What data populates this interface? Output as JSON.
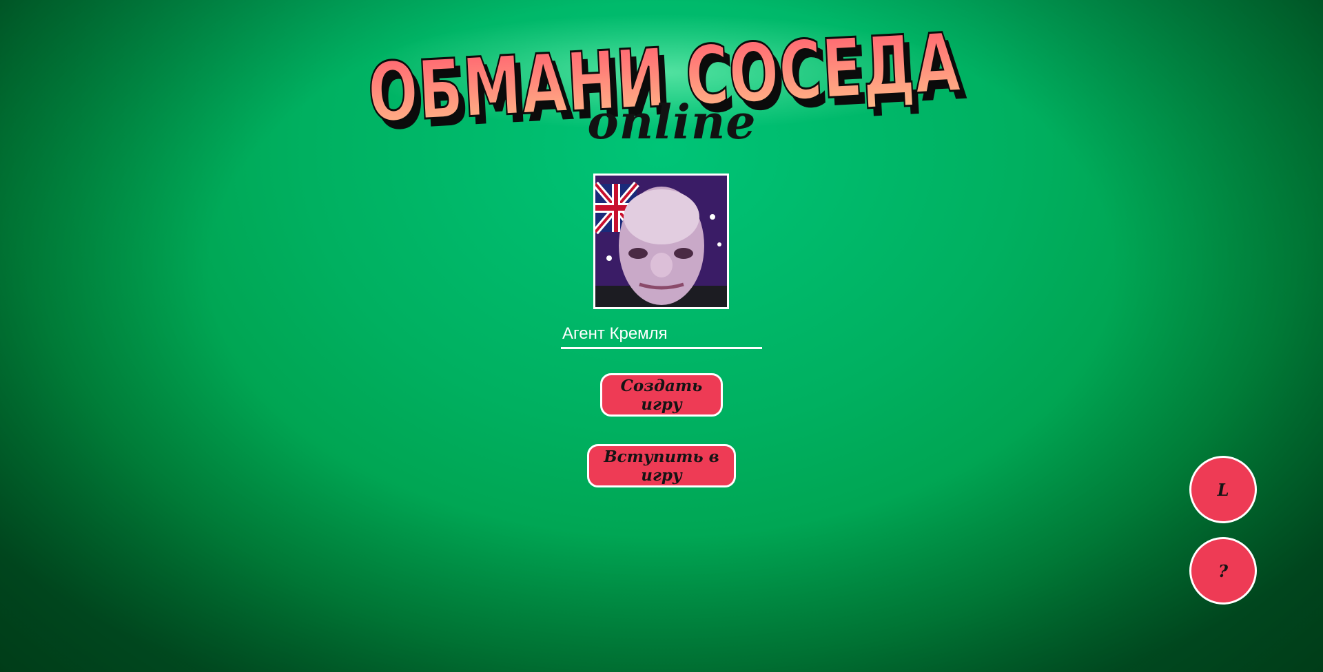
{
  "logo": {
    "title": "ОБМАНИ СОСЕДА",
    "subtitle": "online"
  },
  "player": {
    "name_value": "Агент Кремля"
  },
  "buttons": {
    "create_game": "Создать игру",
    "join_game": "Вступить в игру",
    "language": "L",
    "help": "?"
  },
  "colors": {
    "background": "#00b060",
    "button": "#ee3b55",
    "button_border": "#ffffff",
    "logo_fill_top": "#ff5a6e",
    "logo_fill_bottom": "#ffc08a"
  }
}
